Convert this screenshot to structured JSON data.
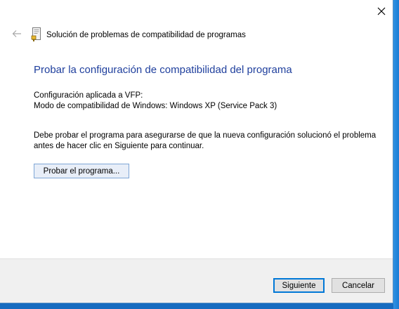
{
  "window": {
    "title": "Solución de problemas de compatibilidad de programas",
    "icons": {
      "close": "close-icon",
      "back": "back-arrow-icon",
      "app": "troubleshooter-icon"
    }
  },
  "content": {
    "heading": "Probar la configuración de compatibilidad del programa",
    "config_applied": "Configuración aplicada a  VFP:",
    "compat_mode": "Modo de compatibilidad de Windows: Windows XP (Service Pack 3)",
    "instructions": "Debe probar el programa para asegurarse de que la nueva configuración solucionó el problema antes de hacer clic en Siguiente para continuar.",
    "test_button": "Probar el programa..."
  },
  "footer": {
    "next_button": "Siguiente",
    "cancel_button": "Cancelar"
  },
  "colors": {
    "heading": "#1f3f9d",
    "desktop": "#1a7ad0",
    "focus_border": "#0078d7"
  }
}
